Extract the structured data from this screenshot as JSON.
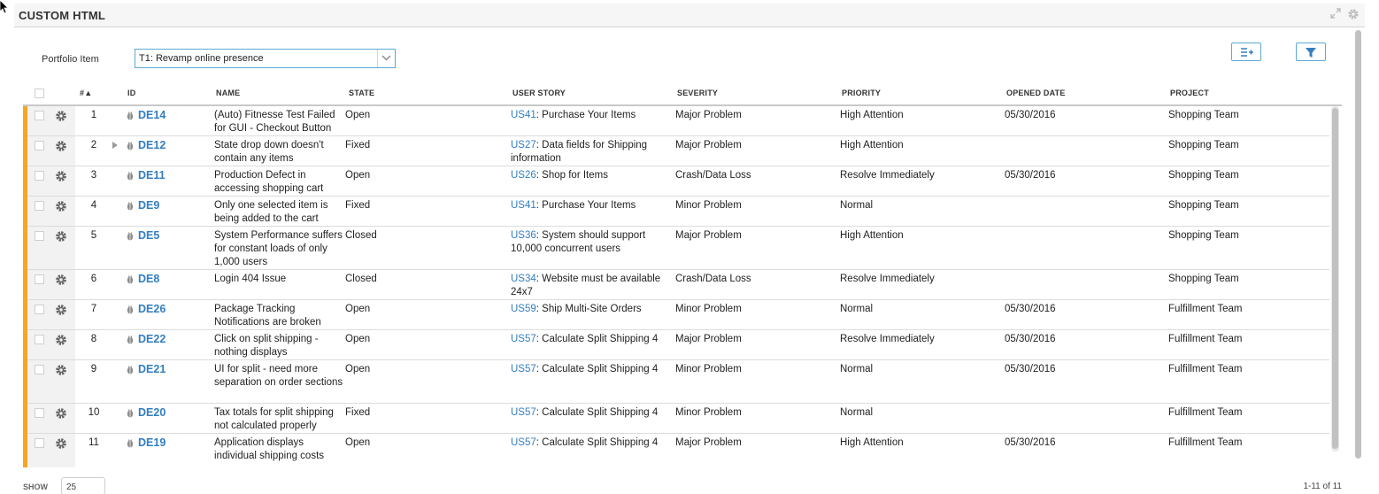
{
  "panel": {
    "title": "CUSTOM HTML",
    "icons": [
      "expand-icon",
      "gear-icon"
    ]
  },
  "filter": {
    "portfolio_label": "Portfolio Item",
    "portfolio_value": "T1: Revamp online presence"
  },
  "toolbar": {
    "buttons": [
      "add-columns-icon",
      "filter-icon"
    ]
  },
  "colors": {
    "accent": "#337ec0",
    "row_stripe": "#f5a623",
    "field_border": "#5aa9d8"
  },
  "grid": {
    "columns": {
      "num": "#",
      "id": "ID",
      "name": "NAME",
      "state": "STATE",
      "user_story": "USER STORY",
      "severity": "SEVERITY",
      "priority": "PRIORITY",
      "opened_date": "OPENED DATE",
      "project": "PROJECT"
    },
    "sort_indicator": "▲",
    "rows": [
      {
        "num": "1",
        "id": "DE14",
        "name": "(Auto) Fitnesse Test Failed for GUI - Checkout Button",
        "state": "Open",
        "story_id": "US41",
        "story_name": ": Purchase Your Items",
        "severity": "Major Problem",
        "priority": "High Attention",
        "opened": "05/30/2016",
        "project": "Shopping Team"
      },
      {
        "num": "2",
        "id": "DE12",
        "name": "State drop down doesn't contain any items",
        "state": "Fixed",
        "story_id": "US27",
        "story_name": ": Data fields for Shipping information",
        "severity": "Major Problem",
        "priority": "High Attention",
        "opened": "",
        "project": "Shopping Team"
      },
      {
        "num": "3",
        "id": "DE11",
        "name": "Production Defect in accessing shopping cart",
        "state": "Open",
        "story_id": "US26",
        "story_name": ": Shop for Items",
        "severity": "Crash/Data Loss",
        "priority": "Resolve Immediately",
        "opened": "05/30/2016",
        "project": "Shopping Team"
      },
      {
        "num": "4",
        "id": "DE9",
        "name": "Only one selected item is being added to the cart",
        "state": "Fixed",
        "story_id": "US41",
        "story_name": ": Purchase Your Items",
        "severity": "Minor Problem",
        "priority": "Normal",
        "opened": "",
        "project": "Shopping Team"
      },
      {
        "num": "5",
        "id": "DE5",
        "name": "System Performance suffers for constant loads of only 1,000 users",
        "state": "Closed",
        "story_id": "US36",
        "story_name": ": System should support 10,000 concurrent users",
        "severity": "Major Problem",
        "priority": "High Attention",
        "opened": "",
        "project": "Shopping Team"
      },
      {
        "num": "6",
        "id": "DE8",
        "name": "Login 404 Issue",
        "state": "Closed",
        "story_id": "US34",
        "story_name": ": Website must be available 24x7",
        "severity": "Crash/Data Loss",
        "priority": "Resolve Immediately",
        "opened": "",
        "project": "Shopping Team"
      },
      {
        "num": "7",
        "id": "DE26",
        "name": "Package Tracking Notifications are broken",
        "state": "Open",
        "story_id": "US59",
        "story_name": ": Ship Multi-Site Orders",
        "severity": "Minor Problem",
        "priority": "Normal",
        "opened": "05/30/2016",
        "project": "Fulfillment Team"
      },
      {
        "num": "8",
        "id": "DE22",
        "name": "Click on split shipping - nothing displays",
        "state": "Open",
        "story_id": "US57",
        "story_name": ": Calculate Split Shipping 4",
        "severity": "Major Problem",
        "priority": "Resolve Immediately",
        "opened": "05/30/2016",
        "project": "Fulfillment Team"
      },
      {
        "num": "9",
        "id": "DE21",
        "name": "UI for split - need more separation on order sections",
        "state": "Open",
        "story_id": "US57",
        "story_name": ": Calculate Split Shipping 4",
        "severity": "Minor Problem",
        "priority": "Normal",
        "opened": "05/30/2016",
        "project": "Fulfillment Team"
      },
      {
        "num": "10",
        "id": "DE20",
        "name": "Tax totals for split shipping not calculated properly",
        "state": "Fixed",
        "story_id": "US57",
        "story_name": ": Calculate Split Shipping 4",
        "severity": "Minor Problem",
        "priority": "Normal",
        "opened": "",
        "project": "Fulfillment Team"
      },
      {
        "num": "11",
        "id": "DE19",
        "name": "Application displays individual shipping costs",
        "state": "Open",
        "story_id": "US57",
        "story_name": ": Calculate Split Shipping 4",
        "severity": "Major Problem",
        "priority": "High Attention",
        "opened": "05/30/2016",
        "project": "Fulfillment Team"
      }
    ]
  },
  "footer": {
    "show_label": "SHOW",
    "page_size": "25",
    "pager": "1-11 of 11"
  }
}
